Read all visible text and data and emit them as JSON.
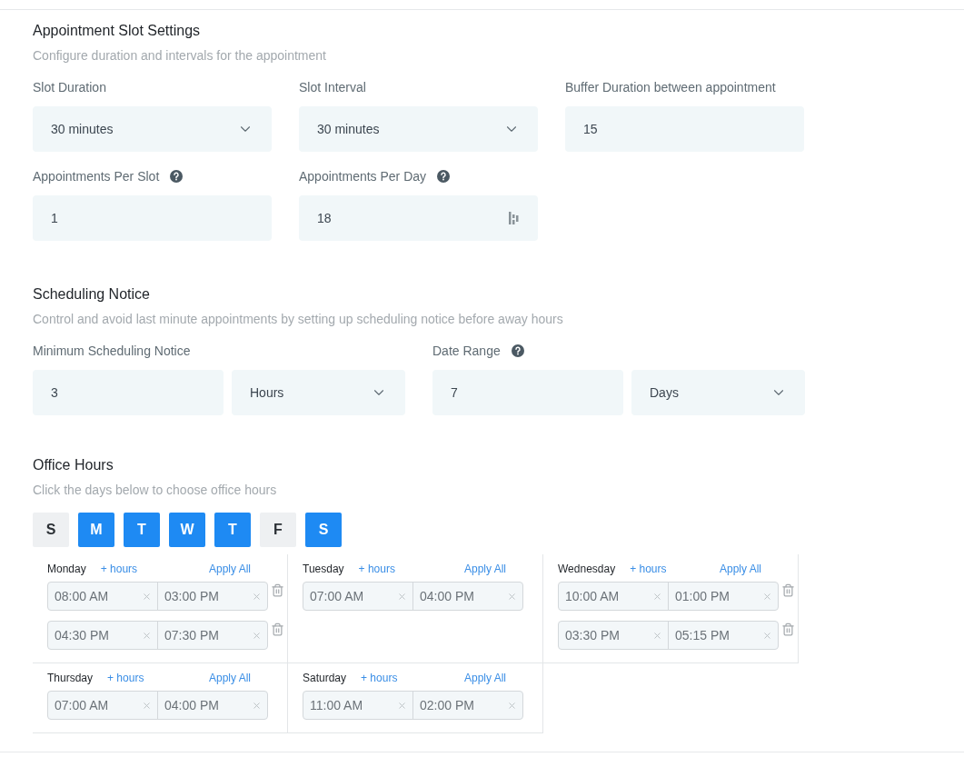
{
  "slot_settings": {
    "title": "Appointment Slot Settings",
    "description": "Configure duration and intervals for the appointment",
    "fields": [
      {
        "kind": "select",
        "label": "Slot Duration",
        "value": "30 minutes",
        "help": false
      },
      {
        "kind": "select",
        "label": "Slot Interval",
        "value": "30 minutes",
        "help": false
      },
      {
        "kind": "input",
        "label": "Buffer Duration between appointment",
        "value": "15",
        "help": false
      },
      {
        "kind": "input",
        "label": "Appointments Per Slot",
        "value": "1",
        "help": true
      },
      {
        "kind": "counter",
        "label": "Appointments Per Day",
        "value": "18",
        "help": true
      }
    ]
  },
  "scheduling_notice": {
    "title": "Scheduling Notice",
    "description": "Control and avoid last minute appointments by setting up scheduling notice before away hours",
    "groups": [
      {
        "label": "Minimum Scheduling Notice",
        "help": false,
        "value": "3",
        "unit": "Hours"
      },
      {
        "label": "Date Range",
        "help": true,
        "value": "7",
        "unit": "Days"
      }
    ]
  },
  "office_hours": {
    "title": "Office Hours",
    "description": "Click the days below to choose office hours",
    "weekdays": [
      {
        "label": "S",
        "selected": false
      },
      {
        "label": "M",
        "selected": true
      },
      {
        "label": "T",
        "selected": true
      },
      {
        "label": "W",
        "selected": true
      },
      {
        "label": "T",
        "selected": true
      },
      {
        "label": "F",
        "selected": false
      },
      {
        "label": "S",
        "selected": true
      }
    ],
    "days": [
      {
        "day": "Monday",
        "add_label": "+ hours",
        "apply_label": "Apply All",
        "ranges": [
          {
            "start": "08:00 AM",
            "end": "03:00 PM"
          },
          {
            "start": "04:30 PM",
            "end": "07:30 PM"
          }
        ]
      },
      {
        "day": "Tuesday",
        "add_label": "+ hours",
        "apply_label": "Apply All",
        "ranges": [
          {
            "start": "07:00 AM",
            "end": "04:00 PM"
          }
        ]
      },
      {
        "day": "Wednesday",
        "add_label": "+ hours",
        "apply_label": "Apply All",
        "ranges": [
          {
            "start": "10:00 AM",
            "end": "01:00 PM"
          },
          {
            "start": "03:30 PM",
            "end": "05:15 PM"
          }
        ]
      },
      {
        "day": "Thursday",
        "add_label": "+ hours",
        "apply_label": "Apply All",
        "ranges": [
          {
            "start": "07:00 AM",
            "end": "04:00 PM"
          }
        ]
      },
      {
        "day": "Saturday",
        "add_label": "+ hours",
        "apply_label": "Apply All",
        "ranges": [
          {
            "start": "11:00 AM",
            "end": "02:00 PM"
          }
        ]
      }
    ]
  }
}
